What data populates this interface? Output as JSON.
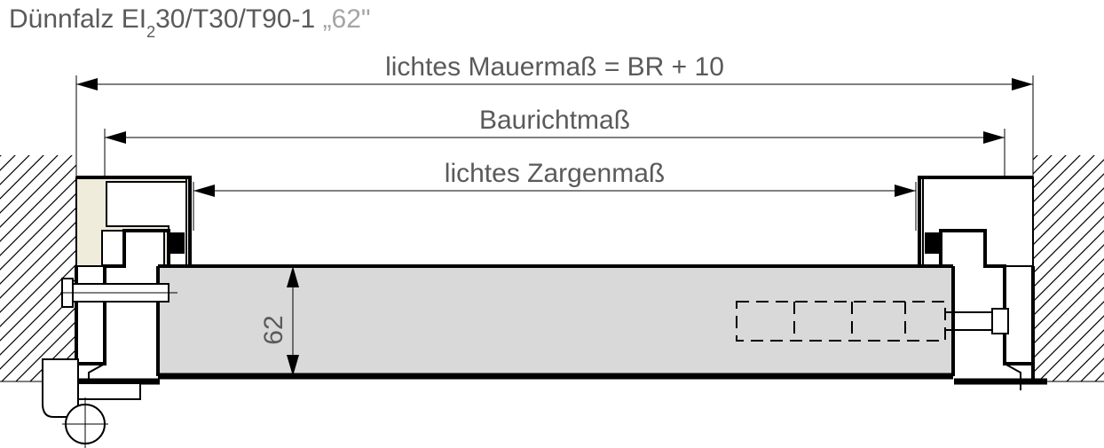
{
  "title": {
    "main_a": "Dünnfalz EI",
    "main_sub": "2",
    "main_b": "30/T30/T90-1",
    "suffix": "„62\""
  },
  "dimensions": {
    "outer": "lichtes Mauermaß = BR + 10",
    "middle": "Baurichtmaß",
    "inner": "lichtes Zargenmaß",
    "thickness": "62"
  },
  "chart_data": {
    "type": "technical-section",
    "description": "Horizontal cross-section of a thin-rebate fire door (EI2 30 / T30 / T90-1) with 62 mm leaf thickness, showing hinge side (left) and lock side (right), steel frame profiles and masonry reveal.",
    "door_leaf_thickness_mm": 62,
    "clear_wall_opening": "BR + 10",
    "labels": [
      "lichtes Mauermaß = BR + 10",
      "Baurichtmaß",
      "lichtes Zargenmaß"
    ]
  }
}
